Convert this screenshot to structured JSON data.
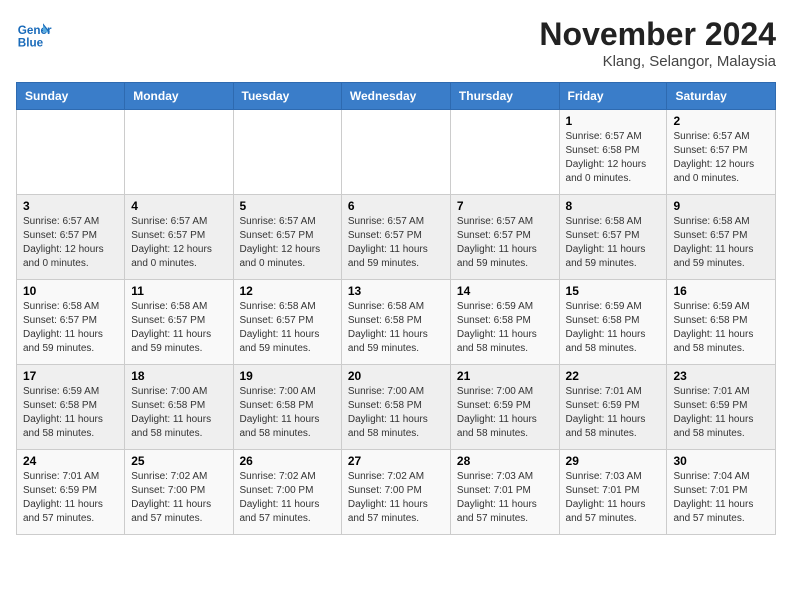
{
  "logo": {
    "line1": "General",
    "line2": "Blue"
  },
  "title": "November 2024",
  "subtitle": "Klang, Selangor, Malaysia",
  "header": {
    "days": [
      "Sunday",
      "Monday",
      "Tuesday",
      "Wednesday",
      "Thursday",
      "Friday",
      "Saturday"
    ]
  },
  "weeks": [
    [
      {
        "day": "",
        "info": ""
      },
      {
        "day": "",
        "info": ""
      },
      {
        "day": "",
        "info": ""
      },
      {
        "day": "",
        "info": ""
      },
      {
        "day": "",
        "info": ""
      },
      {
        "day": "1",
        "info": "Sunrise: 6:57 AM\nSunset: 6:58 PM\nDaylight: 12 hours and 0 minutes."
      },
      {
        "day": "2",
        "info": "Sunrise: 6:57 AM\nSunset: 6:57 PM\nDaylight: 12 hours and 0 minutes."
      }
    ],
    [
      {
        "day": "3",
        "info": "Sunrise: 6:57 AM\nSunset: 6:57 PM\nDaylight: 12 hours and 0 minutes."
      },
      {
        "day": "4",
        "info": "Sunrise: 6:57 AM\nSunset: 6:57 PM\nDaylight: 12 hours and 0 minutes."
      },
      {
        "day": "5",
        "info": "Sunrise: 6:57 AM\nSunset: 6:57 PM\nDaylight: 12 hours and 0 minutes."
      },
      {
        "day": "6",
        "info": "Sunrise: 6:57 AM\nSunset: 6:57 PM\nDaylight: 11 hours and 59 minutes."
      },
      {
        "day": "7",
        "info": "Sunrise: 6:57 AM\nSunset: 6:57 PM\nDaylight: 11 hours and 59 minutes."
      },
      {
        "day": "8",
        "info": "Sunrise: 6:58 AM\nSunset: 6:57 PM\nDaylight: 11 hours and 59 minutes."
      },
      {
        "day": "9",
        "info": "Sunrise: 6:58 AM\nSunset: 6:57 PM\nDaylight: 11 hours and 59 minutes."
      }
    ],
    [
      {
        "day": "10",
        "info": "Sunrise: 6:58 AM\nSunset: 6:57 PM\nDaylight: 11 hours and 59 minutes."
      },
      {
        "day": "11",
        "info": "Sunrise: 6:58 AM\nSunset: 6:57 PM\nDaylight: 11 hours and 59 minutes."
      },
      {
        "day": "12",
        "info": "Sunrise: 6:58 AM\nSunset: 6:57 PM\nDaylight: 11 hours and 59 minutes."
      },
      {
        "day": "13",
        "info": "Sunrise: 6:58 AM\nSunset: 6:58 PM\nDaylight: 11 hours and 59 minutes."
      },
      {
        "day": "14",
        "info": "Sunrise: 6:59 AM\nSunset: 6:58 PM\nDaylight: 11 hours and 58 minutes."
      },
      {
        "day": "15",
        "info": "Sunrise: 6:59 AM\nSunset: 6:58 PM\nDaylight: 11 hours and 58 minutes."
      },
      {
        "day": "16",
        "info": "Sunrise: 6:59 AM\nSunset: 6:58 PM\nDaylight: 11 hours and 58 minutes."
      }
    ],
    [
      {
        "day": "17",
        "info": "Sunrise: 6:59 AM\nSunset: 6:58 PM\nDaylight: 11 hours and 58 minutes."
      },
      {
        "day": "18",
        "info": "Sunrise: 7:00 AM\nSunset: 6:58 PM\nDaylight: 11 hours and 58 minutes."
      },
      {
        "day": "19",
        "info": "Sunrise: 7:00 AM\nSunset: 6:58 PM\nDaylight: 11 hours and 58 minutes."
      },
      {
        "day": "20",
        "info": "Sunrise: 7:00 AM\nSunset: 6:58 PM\nDaylight: 11 hours and 58 minutes."
      },
      {
        "day": "21",
        "info": "Sunrise: 7:00 AM\nSunset: 6:59 PM\nDaylight: 11 hours and 58 minutes."
      },
      {
        "day": "22",
        "info": "Sunrise: 7:01 AM\nSunset: 6:59 PM\nDaylight: 11 hours and 58 minutes."
      },
      {
        "day": "23",
        "info": "Sunrise: 7:01 AM\nSunset: 6:59 PM\nDaylight: 11 hours and 58 minutes."
      }
    ],
    [
      {
        "day": "24",
        "info": "Sunrise: 7:01 AM\nSunset: 6:59 PM\nDaylight: 11 hours and 57 minutes."
      },
      {
        "day": "25",
        "info": "Sunrise: 7:02 AM\nSunset: 7:00 PM\nDaylight: 11 hours and 57 minutes."
      },
      {
        "day": "26",
        "info": "Sunrise: 7:02 AM\nSunset: 7:00 PM\nDaylight: 11 hours and 57 minutes."
      },
      {
        "day": "27",
        "info": "Sunrise: 7:02 AM\nSunset: 7:00 PM\nDaylight: 11 hours and 57 minutes."
      },
      {
        "day": "28",
        "info": "Sunrise: 7:03 AM\nSunset: 7:01 PM\nDaylight: 11 hours and 57 minutes."
      },
      {
        "day": "29",
        "info": "Sunrise: 7:03 AM\nSunset: 7:01 PM\nDaylight: 11 hours and 57 minutes."
      },
      {
        "day": "30",
        "info": "Sunrise: 7:04 AM\nSunset: 7:01 PM\nDaylight: 11 hours and 57 minutes."
      }
    ]
  ]
}
